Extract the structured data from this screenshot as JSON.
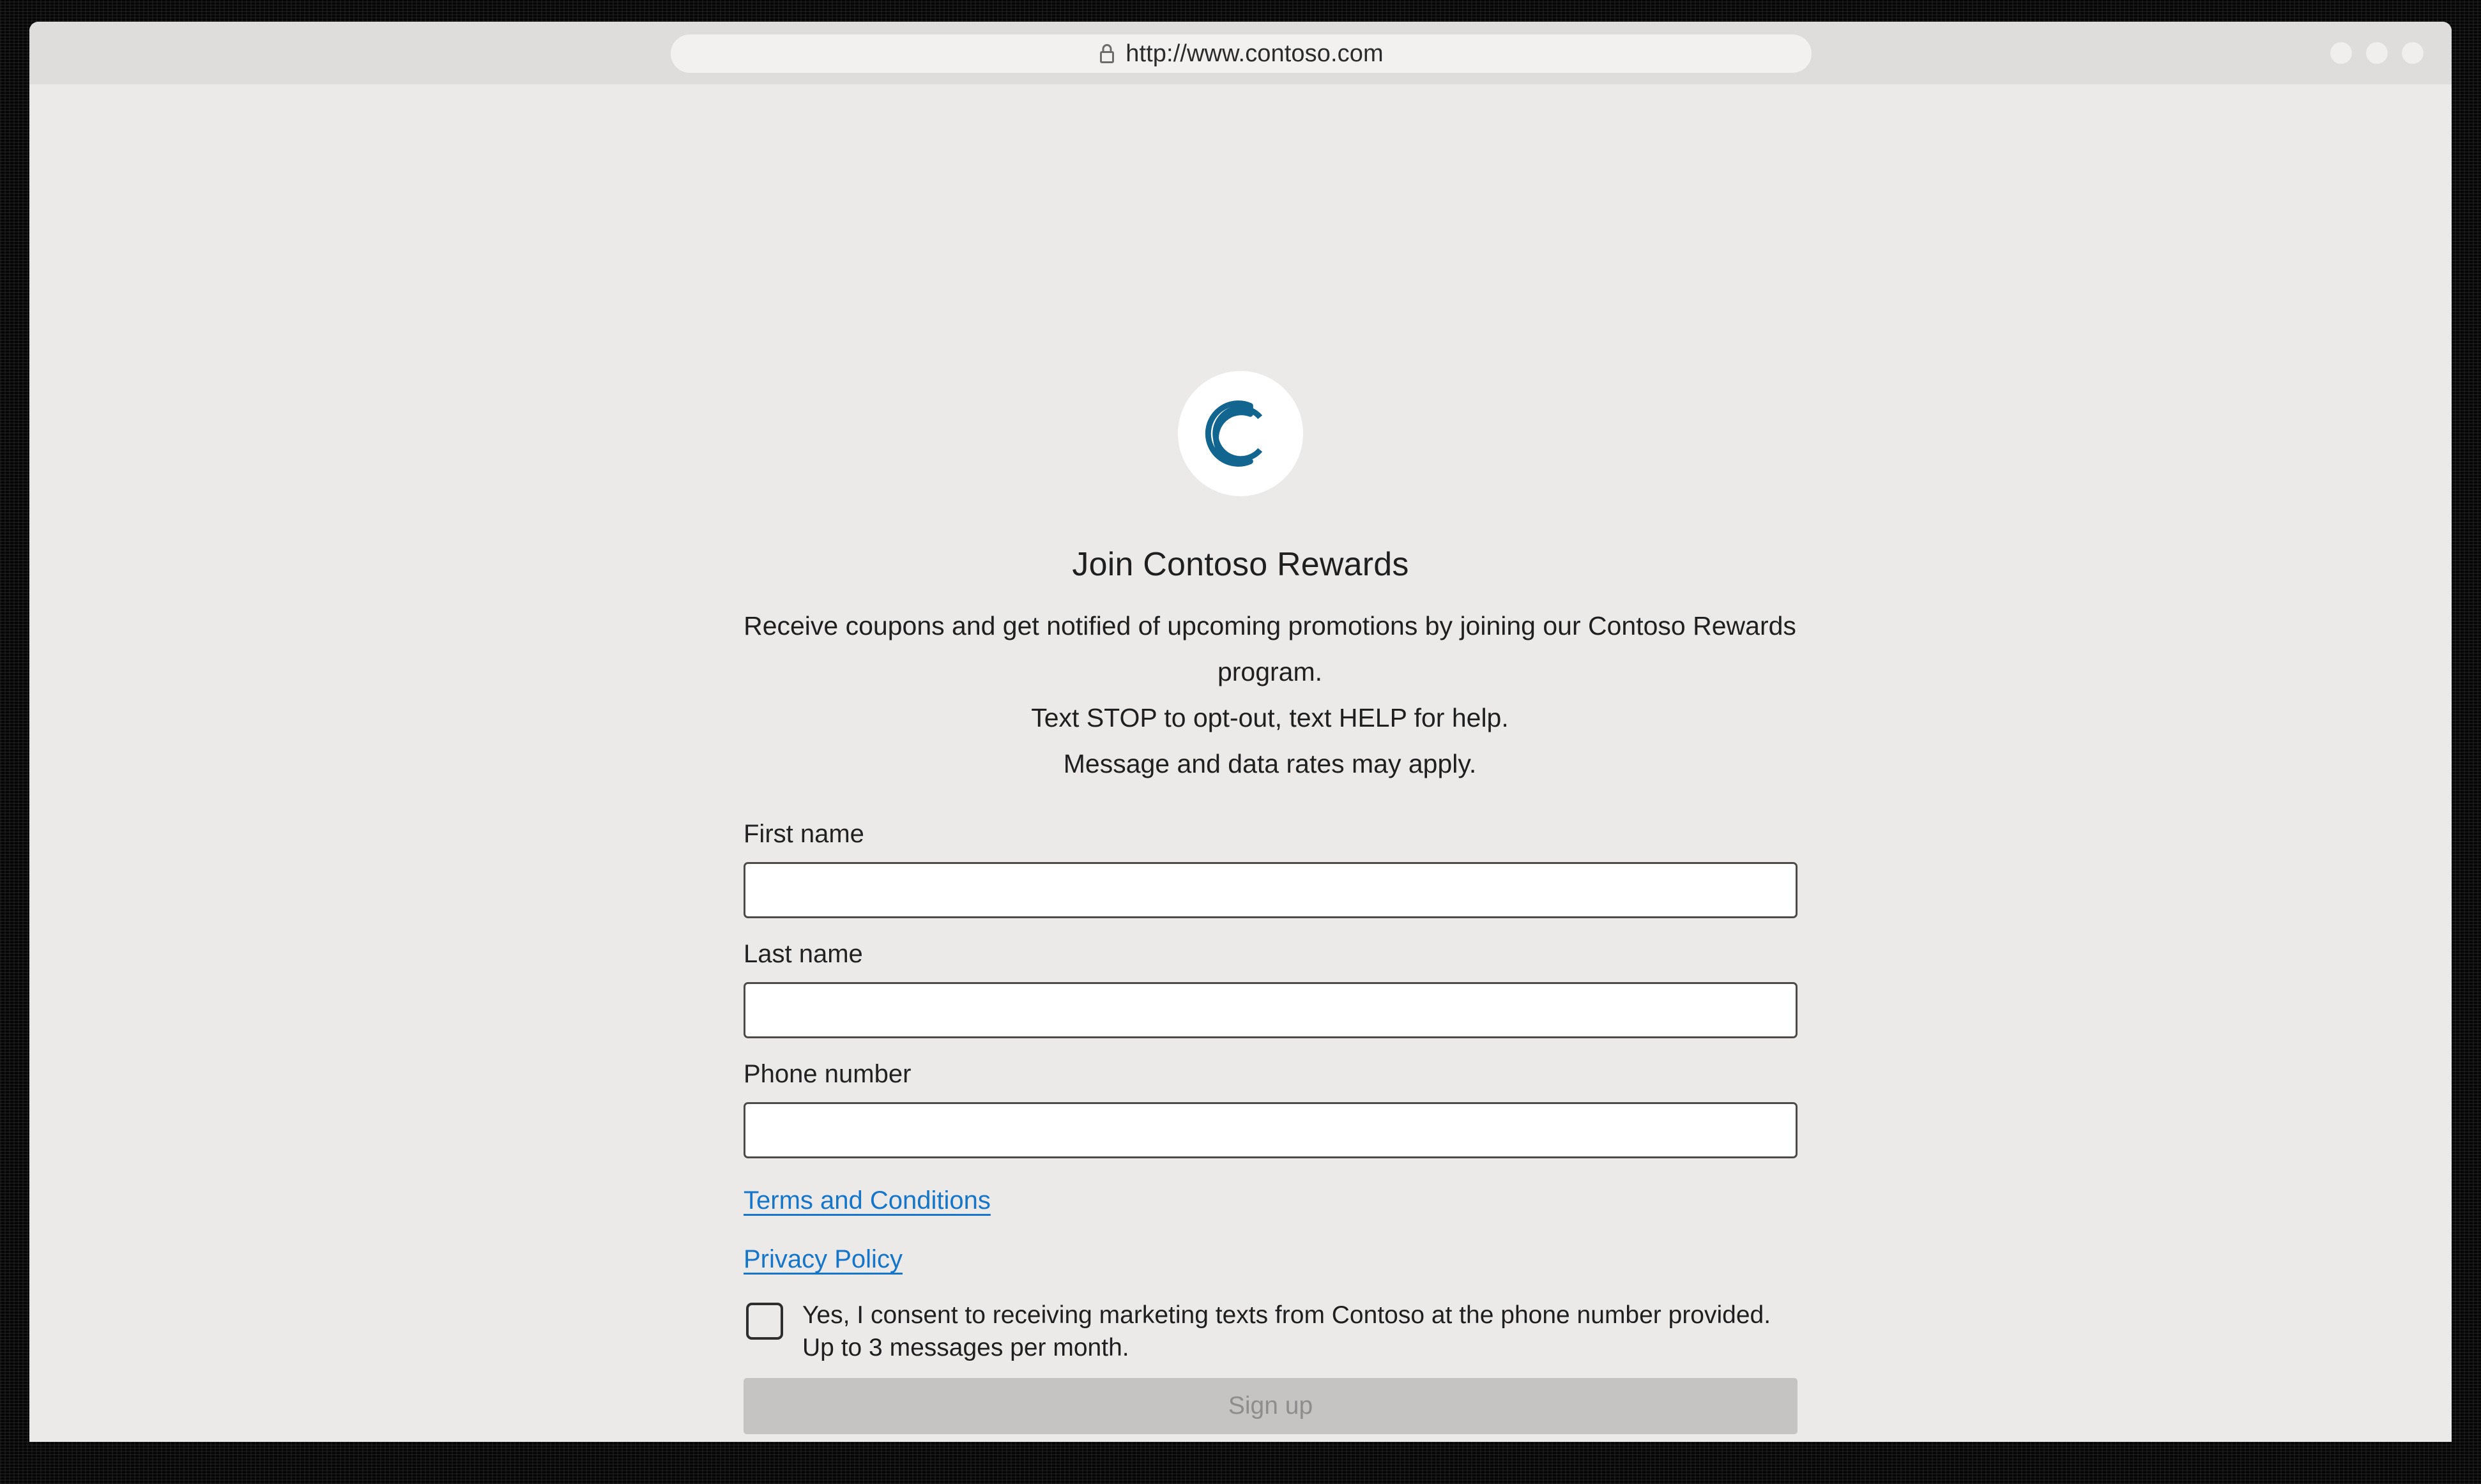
{
  "browser": {
    "url": "http://www.contoso.com",
    "lock_icon": "lock-icon",
    "window_controls": [
      "minimize-dot",
      "maximize-dot",
      "close-dot"
    ]
  },
  "brand": {
    "logo_icon": "contoso-double-c-logo",
    "logo_color": "#11658f",
    "logo_bg": "#ffffff"
  },
  "page": {
    "headline": "Join Contoso Rewards",
    "blurb_lines": [
      "Receive coupons and get notified of upcoming promotions by joining our Contoso Rewards program.",
      "Text STOP to opt-out, text HELP for help.",
      "Message and data rates may apply."
    ]
  },
  "form": {
    "fields": [
      {
        "label": "First name",
        "value": "",
        "placeholder": ""
      },
      {
        "label": "Last name",
        "value": "",
        "placeholder": ""
      },
      {
        "label": "Phone number",
        "value": "",
        "placeholder": ""
      }
    ],
    "links": [
      {
        "label": "Terms and Conditions"
      },
      {
        "label": "Privacy Policy"
      }
    ],
    "consent": {
      "checked": false,
      "text": "Yes, I consent to receiving marketing texts from Contoso at the phone number provided. Up to 3 messages per month."
    },
    "submit": {
      "label": "Sign up",
      "disabled": true
    }
  },
  "colors": {
    "link": "#1575c9",
    "brand": "#11658f",
    "page_bg": "#ebeae9",
    "chrome_bg": "#dedddc",
    "input_border": "#4d4a47",
    "button_disabled_bg": "#c5c4c3",
    "button_disabled_text": "#8e8d8c"
  }
}
